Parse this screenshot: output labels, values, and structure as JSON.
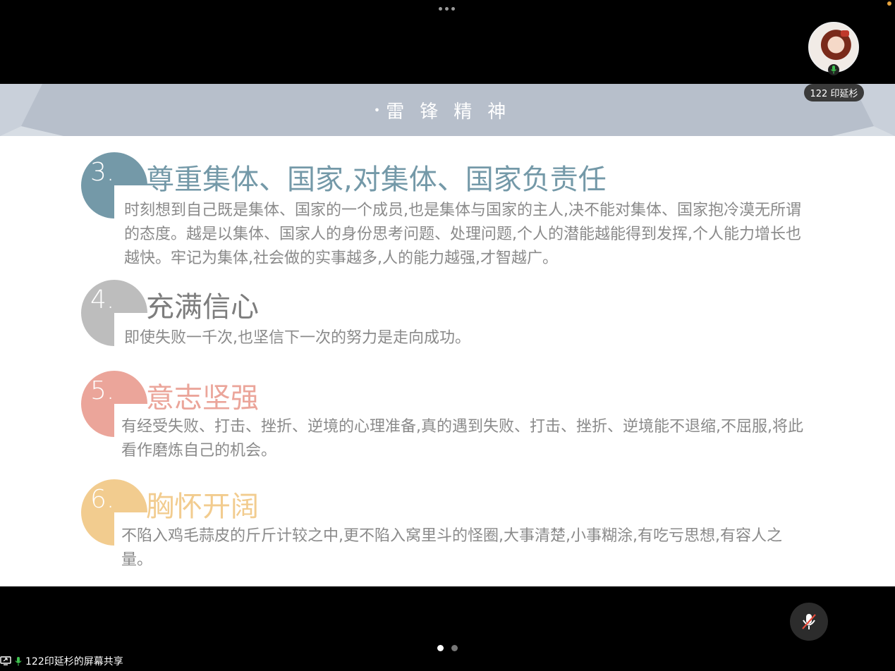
{
  "participant": {
    "name": "122 印延杉"
  },
  "slide": {
    "banner_title": "雷锋精神",
    "items": [
      {
        "number": "3.",
        "heading": "尊重集体、国家,对集体、国家负责任",
        "body": "时刻想到自己既是集体、国家的一个成员,也是集体与国家的主人,决不能对集体、国家抱冷漠无所谓的态度。越是以集体、国家人的身份思考问题、处理问题,个人的潜能越能得到发挥,个人能力增长也越快。牢记为集体,社会做的实事越多,人的能力越强,才智越广。",
        "color": "#7499a8"
      },
      {
        "number": "4.",
        "heading": "充满信心",
        "body": "即使失败一千次,也坚信下一次的努力是走向成功。",
        "color": "#bdbdbd"
      },
      {
        "number": "5.",
        "heading": "意志坚强",
        "body": "有经受失败、打击、挫折、逆境的心理准备,真的遇到失败、打击、挫折、逆境能不退缩,不屈服,将此看作磨炼自己的机会。",
        "color": "#eba59a"
      },
      {
        "number": "6.",
        "heading": "胸怀开阔",
        "body": "不陷入鸡毛蒜皮的斤斤计较之中,更不陷入窝里斗的怪圈,大事清楚,小事糊涂,有吃亏思想,有容人之量。",
        "color": "#f2cc8f"
      }
    ]
  },
  "bottom_bar": {
    "share_label": "122印延杉的屏幕共享"
  },
  "pager": {
    "pages": 2,
    "current": 1
  },
  "colors": {
    "banner": "#b7bfcb",
    "accent_mic": "#3fbf4f",
    "mute_slash": "#e74c3c"
  }
}
